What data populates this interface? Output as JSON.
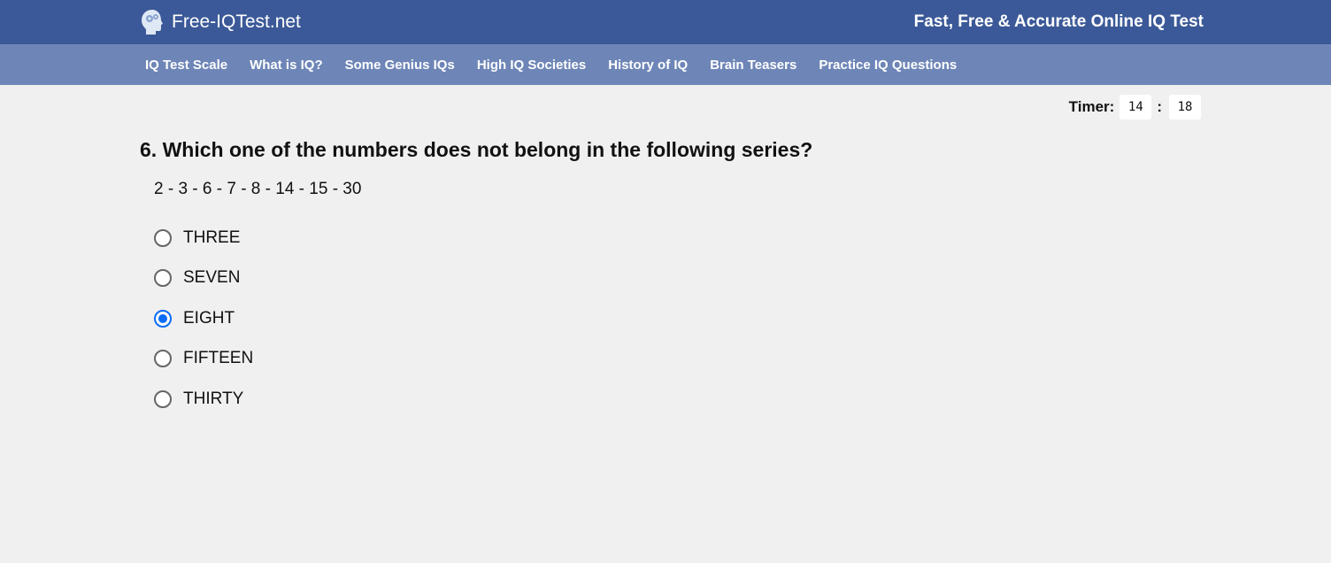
{
  "header": {
    "brand": "Free-IQTest.net",
    "tagline": "Fast, Free & Accurate Online IQ Test",
    "logo_icon": "brain-head-icon"
  },
  "nav": [
    {
      "label": "IQ Test Scale"
    },
    {
      "label": "What is IQ?"
    },
    {
      "label": "Some Genius IQs"
    },
    {
      "label": "High IQ Societies"
    },
    {
      "label": "History of IQ"
    },
    {
      "label": "Brain Teasers"
    },
    {
      "label": "Practice IQ Questions"
    }
  ],
  "timer": {
    "label": "Timer:",
    "minutes": "14",
    "separator": ":",
    "seconds": "18"
  },
  "question": {
    "text": "6. Which one of the numbers does not belong in the following series?",
    "series": "2 - 3 - 6 - 7 - 8 - 14 - 15 - 30",
    "options": [
      {
        "label": "THREE",
        "selected": false
      },
      {
        "label": "SEVEN",
        "selected": false
      },
      {
        "label": "EIGHT",
        "selected": true
      },
      {
        "label": "FIFTEEN",
        "selected": false
      },
      {
        "label": "THIRTY",
        "selected": false
      }
    ]
  },
  "colors": {
    "header_bg": "#3b5998",
    "nav_bg": "#6e86b7",
    "page_bg": "#f0f0f0",
    "radio_selected": "#0a6cf5"
  }
}
